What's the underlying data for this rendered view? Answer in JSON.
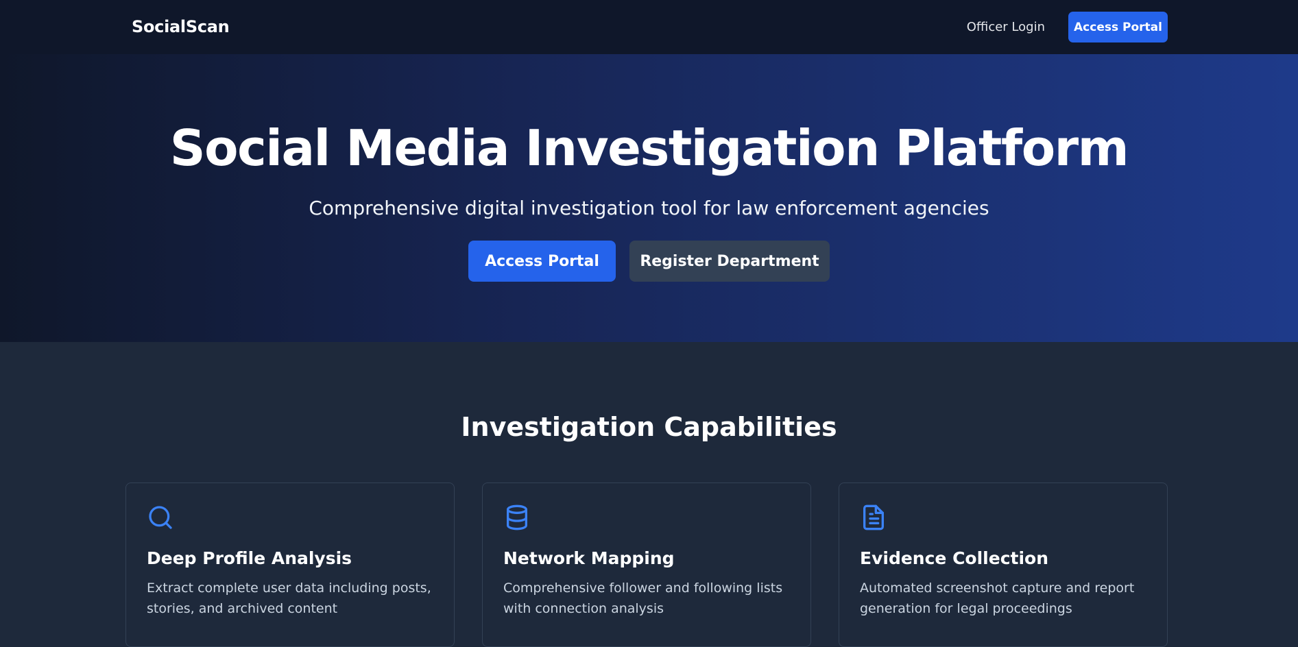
{
  "nav": {
    "brand": "SocialScan",
    "officer_login": "Officer Login",
    "access_portal": "Access Portal"
  },
  "hero": {
    "title": "Social Media Investigation Platform",
    "subtitle": "Comprehensive digital investigation tool for law enforcement agencies",
    "primary_button": "Access Portal",
    "secondary_button": "Register Department"
  },
  "capabilities": {
    "title": "Investigation Capabilities",
    "cards": [
      {
        "icon": "search-icon",
        "title": "Deep Profile Analysis",
        "description": "Extract complete user data including posts, stories, and archived content"
      },
      {
        "icon": "database-icon",
        "title": "Network Mapping",
        "description": "Comprehensive follower and following lists with connection analysis"
      },
      {
        "icon": "document-icon",
        "title": "Evidence Collection",
        "description": "Automated screenshot capture and report generation for legal proceedings"
      }
    ]
  },
  "colors": {
    "accent": "#2563eb",
    "icon": "#3b82f6",
    "nav_bg": "#0f172a",
    "section_bg": "#1e293b",
    "secondary_button": "#334155"
  }
}
